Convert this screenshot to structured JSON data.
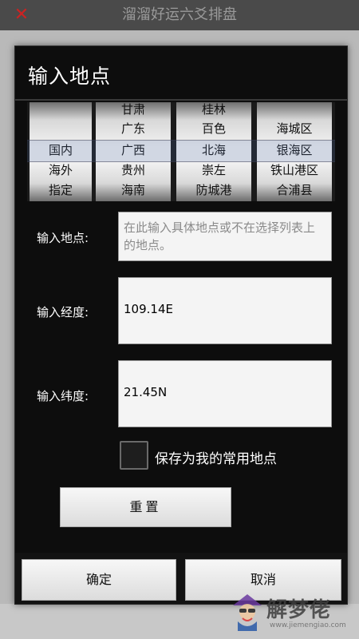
{
  "app": {
    "title": "溜溜好运六爻排盘",
    "logo_glyph": "✕"
  },
  "dialog": {
    "title": "输入地点",
    "picker": {
      "columns": [
        [
          "",
          "",
          "国内",
          "海外",
          "指定"
        ],
        [
          "甘肃",
          "广东",
          "广西",
          "贵州",
          "海南"
        ],
        [
          "桂林",
          "百色",
          "北海",
          "崇左",
          "防城港"
        ],
        [
          "",
          "海城区",
          "银海区",
          "铁山港区",
          "合浦县"
        ]
      ]
    },
    "place": {
      "label": "输入地点:",
      "value": "",
      "placeholder": "在此输入具体地点或不在选择列表上的地点。"
    },
    "longitude": {
      "label": "输入经度:",
      "value": "109.14E"
    },
    "latitude": {
      "label": "输入纬度:",
      "value": "21.45N"
    },
    "save_checkbox": {
      "label": "保存为我的常用地点",
      "checked": false
    },
    "reset_label": "重置",
    "ok_label": "确定",
    "cancel_label": "取消"
  },
  "watermark": {
    "text": "解梦佬",
    "url": "www.jiemengiao.com"
  },
  "colors": {
    "dialog_bg": "#0d0d0d",
    "field_bg": "#f4f4f4",
    "app_logo": "#cc2222"
  }
}
